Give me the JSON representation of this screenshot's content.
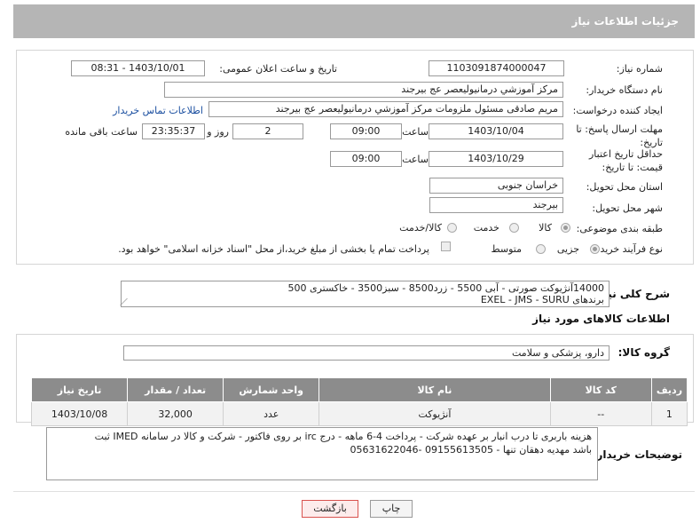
{
  "header": {
    "title": "جزئیات اطلاعات نیاز"
  },
  "form": {
    "need_number_label": "شماره نیاز:",
    "need_number": "1103091874000047",
    "announce_label": "تاریخ و ساعت اعلان عمومی:",
    "announce_value": "1403/10/01 - 08:31",
    "buyer_label": "نام دستگاه خریدار:",
    "buyer_value": "مرکز آموزشي درمانيوليعصر  عج  بيرجند",
    "creator_label": "ایجاد کننده درخواست:",
    "creator_value": "مریم صادقی مسئول ملزومات مرکز آموزشي درمانيوليعصر  عج  بيرجند",
    "contact_link": "اطلاعات تماس خریدار",
    "deadline_label": "مهلت ارسال پاسخ: تا تاریخ:",
    "deadline_date": "1403/10/04",
    "hour_label": "ساعت",
    "deadline_time": "09:00",
    "days_value": "2",
    "days_label": "روز و",
    "remaining_time": "23:35:37",
    "remaining_label": "ساعت باقی مانده",
    "validity_label": "حداقل تاریخ اعتبار قیمت: تا تاریخ:",
    "validity_date": "1403/10/29",
    "validity_time": "09:00",
    "province_label": "استان محل تحویل:",
    "province_value": "خراسان جنوبی",
    "city_label": "شهر محل تحویل:",
    "city_value": "بیرجند",
    "category_label": "طبقه بندی موضوعی:",
    "category_options": [
      "کالا",
      "خدمت",
      "کالا/خدمت"
    ],
    "process_label": "نوع فرآیند خرید :",
    "process_options": [
      "جزیی",
      "متوسط"
    ],
    "payment_note": "پرداخت تمام یا بخشی از مبلغ خرید،از محل \"اسناد خزانه اسلامی\" خواهد بود."
  },
  "description": {
    "label": "شرح کلی نیاز:",
    "line1": "14000آنژیوکت صورتی - آبی 5500 - زرد8500 - سبز3500 - خاکستری 500",
    "line2": "برندهای EXEL - JMS - SURU"
  },
  "goods": {
    "section_title": "اطلاعات کالاهای مورد نیاز",
    "group_label": "گروه کالا:",
    "group_value": "دارو، پزشکی و سلامت",
    "columns": [
      "ردیف",
      "کد کالا",
      "نام کالا",
      "واحد شمارش",
      "تعداد / مقدار",
      "تاریخ نیاز"
    ],
    "rows": [
      [
        "1",
        "--",
        "آنژیوکت",
        "عدد",
        "32,000",
        "1403/10/08"
      ]
    ]
  },
  "buyer_notes": {
    "label": "توضیحات خریدار:",
    "line1": "هزینه باربری تا درب انبار بر عهده شرکت - پرداخت 4-6 ماهه - درج irc بر روی فاکتور - شرکت و کالا در سامانه IMED ثبت",
    "line2": "باشد  مهدیه دهقان تنها - 09155613505 -05631622046"
  },
  "buttons": {
    "print": "چاپ",
    "back": "بازگشت"
  },
  "colors": {
    "header_bg": "#b5b5b5",
    "table_header_bg": "#8c8c8c",
    "link": "#1b4fa0",
    "back_button_border": "#d9534f"
  }
}
